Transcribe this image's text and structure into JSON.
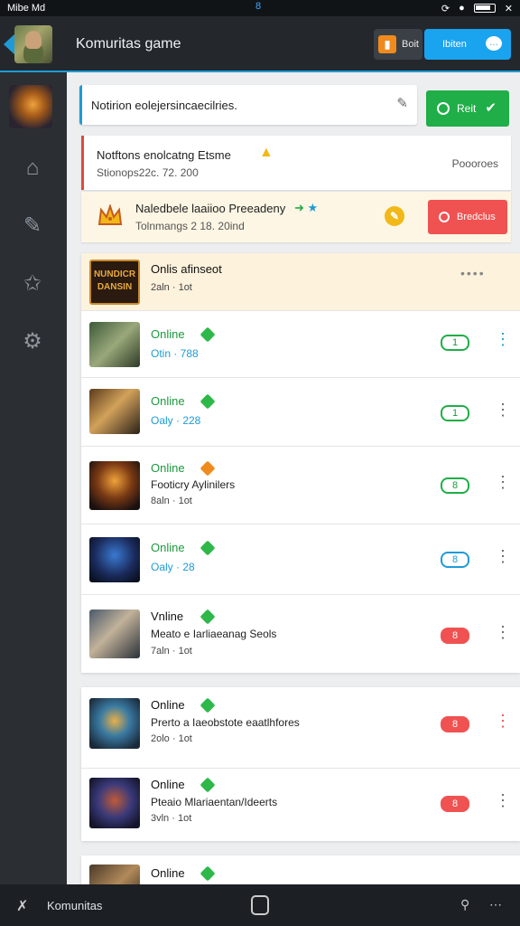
{
  "statusbar": {
    "left": "Mibe Md",
    "center": "8"
  },
  "header": {
    "title": "Komuritas game",
    "btn1_label": "Boit",
    "btn2_label": "Ibiten",
    "chat_glyph": "…"
  },
  "search": {
    "value": "Notirion eolejersincaecilries."
  },
  "green_button": {
    "label": "Reit"
  },
  "notification1": {
    "title": "Notftons enolcatng Etsme",
    "sub": "Stionops22c. 72. 200",
    "right": "Poooroes"
  },
  "notification2": {
    "title": "Naledbele laaiioo Preeadeny",
    "sub": "Tolnmangs 2 18. 20ind"
  },
  "red_button": {
    "label": "Bredclus"
  },
  "list1": {
    "header": {
      "title": "Onlis afinseot",
      "sub": "2aln · 1ot",
      "thumb_text": "NUNDICR DANSIN"
    },
    "rows": [
      {
        "status": "Online",
        "sub": "Otin · 788",
        "badge": "1"
      },
      {
        "status": "Online",
        "sub": "Oaly · 228",
        "badge": "1"
      },
      {
        "status": "Online",
        "desc": "Footicry Aylinilers",
        "meta": "8aln · 1ot",
        "badge": "8"
      },
      {
        "status": "Online",
        "sub": "Oaly · 28",
        "badge": "8"
      },
      {
        "status": "Vnline",
        "desc": "Meato e Iarliaeanag Seols",
        "meta": "7aln · 1ot",
        "badge": "8"
      }
    ]
  },
  "list2": {
    "rows": [
      {
        "status": "Online",
        "desc": "Prerto a Iaeobstote eaatlhfores",
        "meta": "2olo · 1ot",
        "badge": "8"
      },
      {
        "status": "Online",
        "desc": "Pteaio Mlariaentan/Ideerts",
        "meta": "3vln · 1ot",
        "badge": "8"
      }
    ]
  },
  "list3": {
    "rows": [
      {
        "status": "Online"
      }
    ]
  },
  "bottombar": {
    "label": "Komunitas"
  }
}
